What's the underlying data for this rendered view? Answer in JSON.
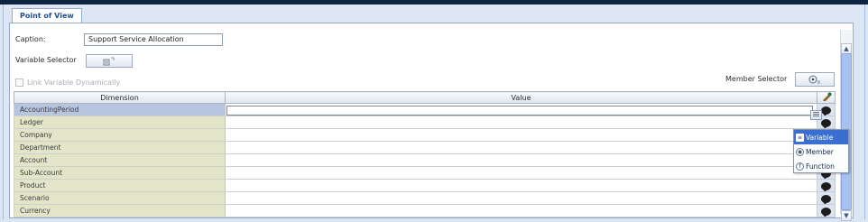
{
  "tab": {
    "label": "Point of View"
  },
  "caption": {
    "label": "Caption:",
    "value": "Support Service Allocation"
  },
  "variable_selector": {
    "label": "Variable Selector",
    "icon": "variable-selector-icon"
  },
  "link_variable": {
    "label": "Link Variable Dynamically",
    "checked": false,
    "enabled": false
  },
  "member_selector": {
    "label": "Member Selector",
    "icon": "member-selector-icon"
  },
  "grid": {
    "headers": {
      "dimension": "Dimension",
      "value": "Value"
    },
    "rows": [
      {
        "dimension": "AccountingPeriod",
        "value": ""
      },
      {
        "dimension": "Ledger",
        "value": ""
      },
      {
        "dimension": "Company",
        "value": ""
      },
      {
        "dimension": "Department",
        "value": ""
      },
      {
        "dimension": "Account",
        "value": ""
      },
      {
        "dimension": "Sub-Account",
        "value": ""
      },
      {
        "dimension": "Product",
        "value": ""
      },
      {
        "dimension": "Scenario",
        "value": ""
      },
      {
        "dimension": "Currency",
        "value": ""
      }
    ]
  },
  "context_menu": {
    "items": [
      {
        "label": "Variable",
        "icon": "variable-icon"
      },
      {
        "label": "Member",
        "icon": "member-icon"
      },
      {
        "label": "Function",
        "icon": "function-icon"
      }
    ]
  },
  "colors": {
    "accent": "#3a6fd1",
    "dimension_cell": "#e3e5c8",
    "selected_row": "#b8c5de",
    "header_bar": "#0d2541"
  }
}
